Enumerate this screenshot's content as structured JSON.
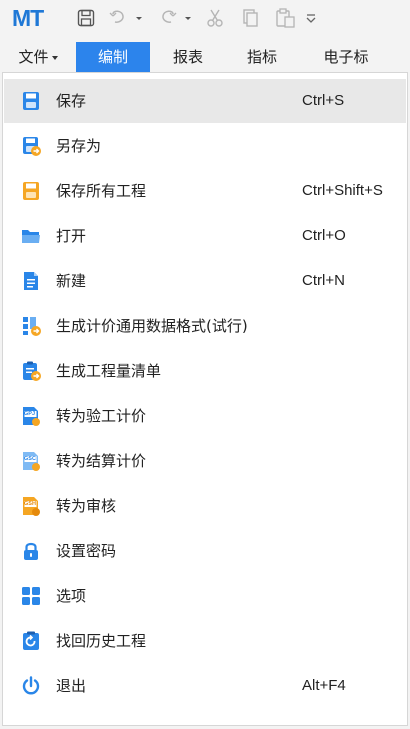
{
  "app": {
    "logo": "MT"
  },
  "quick_access": {
    "save_icon": "save-icon",
    "undo_icon": "undo-icon",
    "redo_icon": "redo-icon",
    "cut_icon": "cut-icon",
    "copy_icon": "copy-icon",
    "paste_icon": "paste-icon",
    "customize_icon": "customize-icon"
  },
  "menubar": {
    "items": [
      {
        "label": "文件",
        "has_caret": true
      },
      {
        "label": "编制",
        "active": true
      },
      {
        "label": "报表"
      },
      {
        "label": "指标"
      },
      {
        "label": "电子标"
      }
    ]
  },
  "dropdown": {
    "items": [
      {
        "label": "保存",
        "shortcut": "Ctrl+S",
        "icon": "save-icon",
        "highlighted": true
      },
      {
        "label": "另存为",
        "shortcut": "",
        "icon": "save-as-icon"
      },
      {
        "label": "保存所有工程",
        "shortcut": "Ctrl+Shift+S",
        "icon": "save-all-icon"
      },
      {
        "label": "打开",
        "shortcut": "Ctrl+O",
        "icon": "folder-open-icon"
      },
      {
        "label": "新建",
        "shortcut": "Ctrl+N",
        "icon": "new-document-icon"
      },
      {
        "label": "生成计价通用数据格式(试行)",
        "shortcut": "",
        "icon": "export-data-format-icon"
      },
      {
        "label": "生成工程量清单",
        "shortcut": "",
        "icon": "quantity-list-icon"
      },
      {
        "label": "转为验工计价",
        "shortcut": "",
        "icon": "gpj-convert-icon",
        "badge": "GPJ"
      },
      {
        "label": "转为结算计价",
        "shortcut": "",
        "icon": "gsc-convert-icon",
        "badge": "GSC"
      },
      {
        "label": "转为审核",
        "shortcut": "",
        "icon": "gsh-convert-icon",
        "badge": "GSH"
      },
      {
        "label": "设置密码",
        "shortcut": "",
        "icon": "lock-icon"
      },
      {
        "label": "选项",
        "shortcut": "",
        "icon": "options-grid-icon"
      },
      {
        "label": "找回历史工程",
        "shortcut": "",
        "icon": "history-restore-icon"
      },
      {
        "label": "退出",
        "shortcut": "Alt+F4",
        "icon": "power-icon"
      }
    ]
  },
  "colors": {
    "accent": "#2c84ec",
    "icon_blue": "#2a86e8",
    "icon_orange": "#f5a623",
    "hover": "#e8e8e8"
  }
}
